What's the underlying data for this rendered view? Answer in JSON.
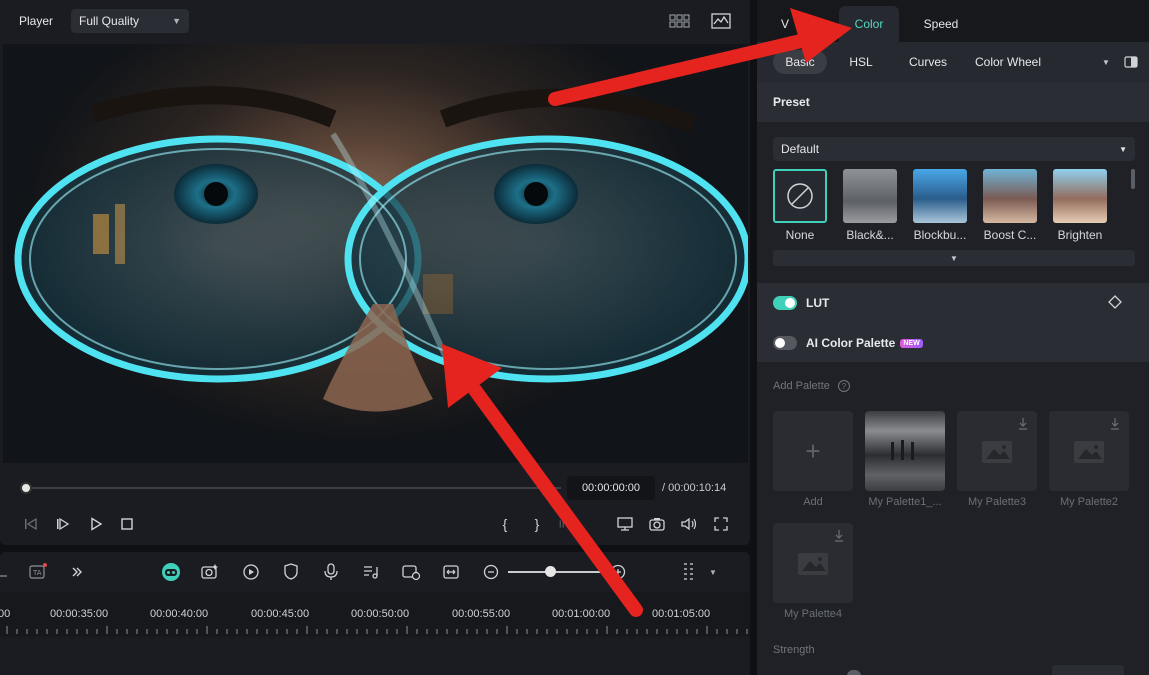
{
  "player": {
    "label": "Player",
    "quality": "Full Quality",
    "current_time": "00:00:00:00",
    "total_time": "/  00:00:10:14"
  },
  "controls": {
    "mark_in": "{",
    "mark_out": "}"
  },
  "timeline": {
    "ruler_labels": [
      "00",
      "00:00:35:00",
      "00:00:40:00",
      "00:00:45:00",
      "00:00:50:00",
      "00:00:55:00",
      "00:01:00:00",
      "00:01:05:00"
    ],
    "zoom_level": 0.42
  },
  "panel": {
    "tabs": [
      {
        "label": "V"
      },
      {
        "label": "Color"
      },
      {
        "label": "Speed"
      }
    ],
    "subtabs": [
      {
        "label": "Basic"
      },
      {
        "label": "HSL"
      },
      {
        "label": "Curves"
      },
      {
        "label": "Color Wheel"
      }
    ],
    "preset": {
      "title": "Preset",
      "selected": "Default",
      "items": [
        "None",
        "Black&...",
        "Blockbu...",
        "Boost C...",
        "Brighten"
      ]
    },
    "lut": {
      "label": "LUT",
      "enabled": true
    },
    "ai_palette": {
      "label": "AI Color Palette",
      "badge": "NEW",
      "enabled": false
    },
    "add_palette": {
      "title": "Add Palette",
      "help": "?",
      "add_plus": "+",
      "items": [
        "Add",
        "My Palette1_...",
        "My Palette3",
        "My Palette2",
        "My Palette4"
      ]
    },
    "strength": {
      "label": "Strength"
    }
  },
  "colors": {
    "accent": "#55d7c7",
    "toggle_on": "#3fd0ba",
    "arrow": "#e5231f"
  }
}
